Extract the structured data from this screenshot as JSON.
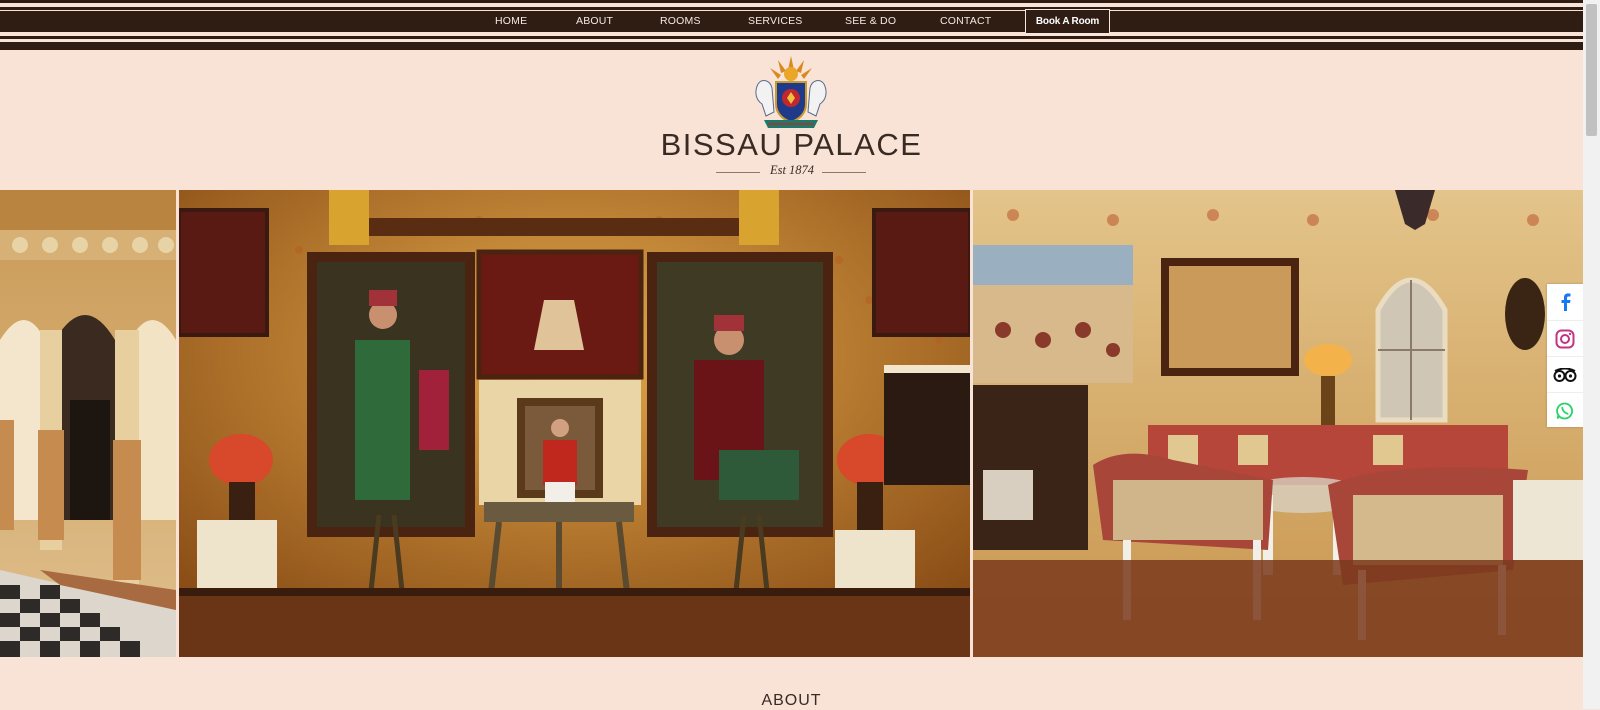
{
  "nav": {
    "items": [
      {
        "label": "HOME"
      },
      {
        "label": "ABOUT"
      },
      {
        "label": "ROOMS"
      },
      {
        "label": "SERVICES"
      },
      {
        "label": "SEE & DO"
      },
      {
        "label": "CONTACT"
      }
    ],
    "book_label": "Book A Room"
  },
  "brand": {
    "name": "BISSAU PALACE",
    "established": "Est 1874"
  },
  "gallery": {
    "photos": [
      {
        "subject": "courtyard-arches"
      },
      {
        "subject": "portrait-hall"
      },
      {
        "subject": "lounge-sitting-room"
      }
    ]
  },
  "social": {
    "icons": [
      "facebook-icon",
      "instagram-icon",
      "tripadvisor-icon",
      "whatsapp-icon"
    ]
  },
  "section": {
    "title": "ABOUT"
  },
  "colors": {
    "band": "#2f1d14",
    "page_background": "#f8e3d6",
    "text_dark": "#3a2a24",
    "facebook": "#1877f2",
    "instagram": "#c13584",
    "whatsapp": "#25d366"
  }
}
